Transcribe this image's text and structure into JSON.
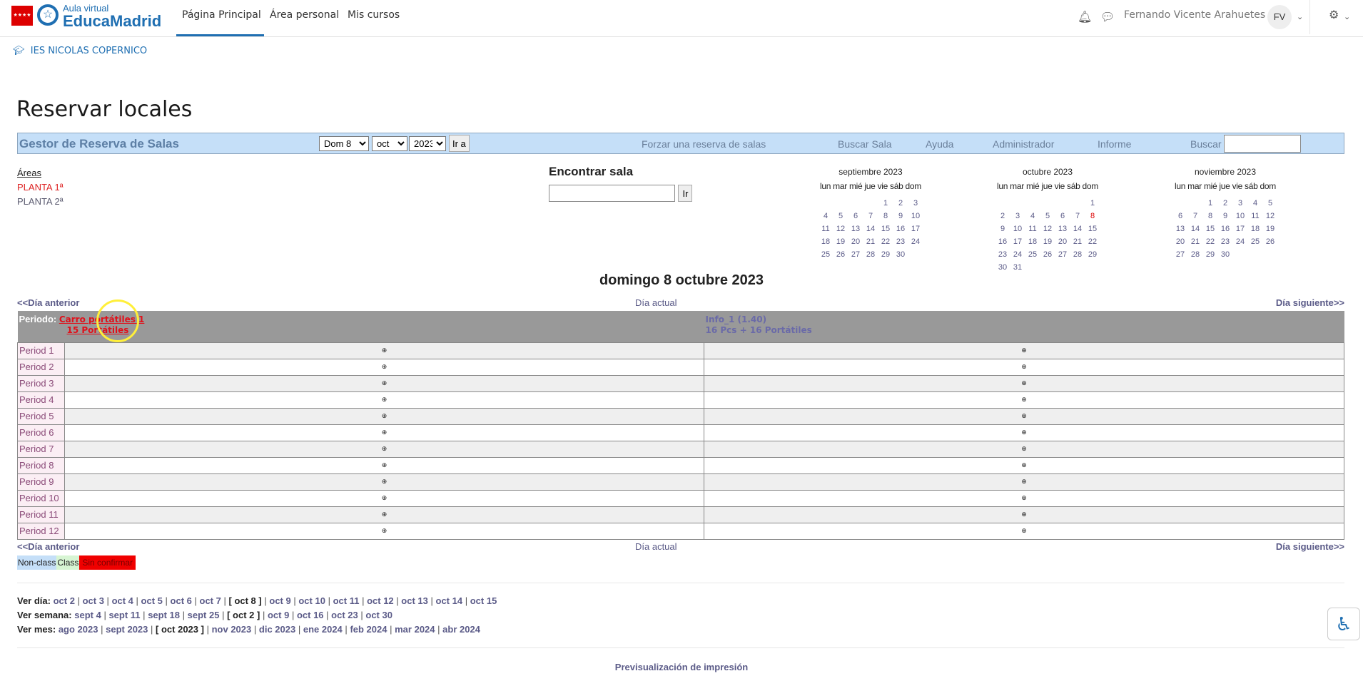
{
  "topbar": {
    "logo_line1": "Aula virtual",
    "logo_line2": "EducaMadrid",
    "nav": [
      "Página Principal",
      "Área personal",
      "Mis cursos"
    ],
    "user_name": "Fernando Vicente Arahuetes",
    "avatar_initials": "FV"
  },
  "breadcrumb": "IES NICOLAS COPERNICO",
  "page_title": "Reservar locales",
  "header": {
    "title": "Gestor de Reserva de Salas",
    "day": "Dom 8",
    "month": "oct",
    "year": "2023",
    "go": "Ir a",
    "links": [
      "Forzar una reserva de salas",
      "Buscar Sala",
      "Ayuda",
      "Administrador",
      "Informe"
    ],
    "search_label": "Buscar",
    "search_value": ""
  },
  "areas": {
    "label": "Áreas",
    "items": [
      "PLANTA 1ª",
      "PLANTA 2ª"
    ]
  },
  "find_room": {
    "title": "Encontrar sala",
    "value": "",
    "button": "Ir"
  },
  "calendars": [
    {
      "title": "septiembre 2023",
      "weeks": [
        [
          "",
          "",
          "",
          "",
          "1",
          "2",
          "3"
        ],
        [
          "4",
          "5",
          "6",
          "7",
          "8",
          "9",
          "10"
        ],
        [
          "11",
          "12",
          "13",
          "14",
          "15",
          "16",
          "17"
        ],
        [
          "18",
          "19",
          "20",
          "21",
          "22",
          "23",
          "24"
        ],
        [
          "25",
          "26",
          "27",
          "28",
          "29",
          "30",
          ""
        ]
      ]
    },
    {
      "title": "octubre 2023",
      "today": "8",
      "weeks": [
        [
          "",
          "",
          "",
          "",
          "",
          "",
          "1"
        ],
        [
          "2",
          "3",
          "4",
          "5",
          "6",
          "7",
          "8"
        ],
        [
          "9",
          "10",
          "11",
          "12",
          "13",
          "14",
          "15"
        ],
        [
          "16",
          "17",
          "18",
          "19",
          "20",
          "21",
          "22"
        ],
        [
          "23",
          "24",
          "25",
          "26",
          "27",
          "28",
          "29"
        ],
        [
          "30",
          "31",
          "",
          "",
          "",
          "",
          ""
        ]
      ]
    },
    {
      "title": "noviembre 2023",
      "weeks": [
        [
          "",
          "",
          "1",
          "2",
          "3",
          "4",
          "5"
        ],
        [
          "6",
          "7",
          "8",
          "9",
          "10",
          "11",
          "12"
        ],
        [
          "13",
          "14",
          "15",
          "16",
          "17",
          "18",
          "19"
        ],
        [
          "20",
          "21",
          "22",
          "23",
          "24",
          "25",
          "26"
        ],
        [
          "27",
          "28",
          "29",
          "30",
          "",
          "",
          ""
        ]
      ]
    }
  ],
  "weekdays": "lun mar mié jue vie sáb dom",
  "day_title": "domingo 8 octubre 2023",
  "day_nav": {
    "prev": "<<Día anterior",
    "today": "Día actual",
    "next": "Día siguiente>>"
  },
  "grid": {
    "period_label": "Periodo:",
    "rooms": [
      {
        "name": "Carro portátiles 1",
        "desc": "15 Portátiles"
      },
      {
        "name": "Info_1 (1.40)",
        "desc": "16 Pcs + 16 Portátiles"
      }
    ],
    "periods": [
      "Period 1",
      "Period 2",
      "Period 3",
      "Period 4",
      "Period 5",
      "Period 6",
      "Period 7",
      "Period 8",
      "Period 9",
      "Period 10",
      "Period 11",
      "Period 12"
    ],
    "cell_symbol": "⊕"
  },
  "legend": [
    {
      "label": "Non-class",
      "color": "#c5dff8"
    },
    {
      "label": "Class",
      "color": "#d7f5d3"
    },
    {
      "label": "Sin confirmar",
      "color": "#f00000"
    }
  ],
  "views": [
    {
      "label": "Ver día:",
      "items": [
        "oct 2",
        "oct 3",
        "oct 4",
        "oct 5",
        "oct 6",
        "oct 7",
        "[ oct 8 ]",
        "oct 9",
        "oct 10",
        "oct 11",
        "oct 12",
        "oct 13",
        "oct 14",
        "oct 15"
      ]
    },
    {
      "label": "Ver semana:",
      "items": [
        "sept 4",
        "sept 11",
        "sept 18",
        "sept 25",
        "[ oct 2 ]",
        "oct 9",
        "oct 16",
        "oct 23",
        "oct 30"
      ]
    },
    {
      "label": "Ver mes:",
      "items": [
        "ago 2023",
        "sept 2023",
        "[ oct 2023 ]",
        "nov 2023",
        "dic 2023",
        "ene 2024",
        "feb 2024",
        "mar 2024",
        "abr 2024"
      ]
    }
  ],
  "print_preview": "Previsualización de impresión"
}
